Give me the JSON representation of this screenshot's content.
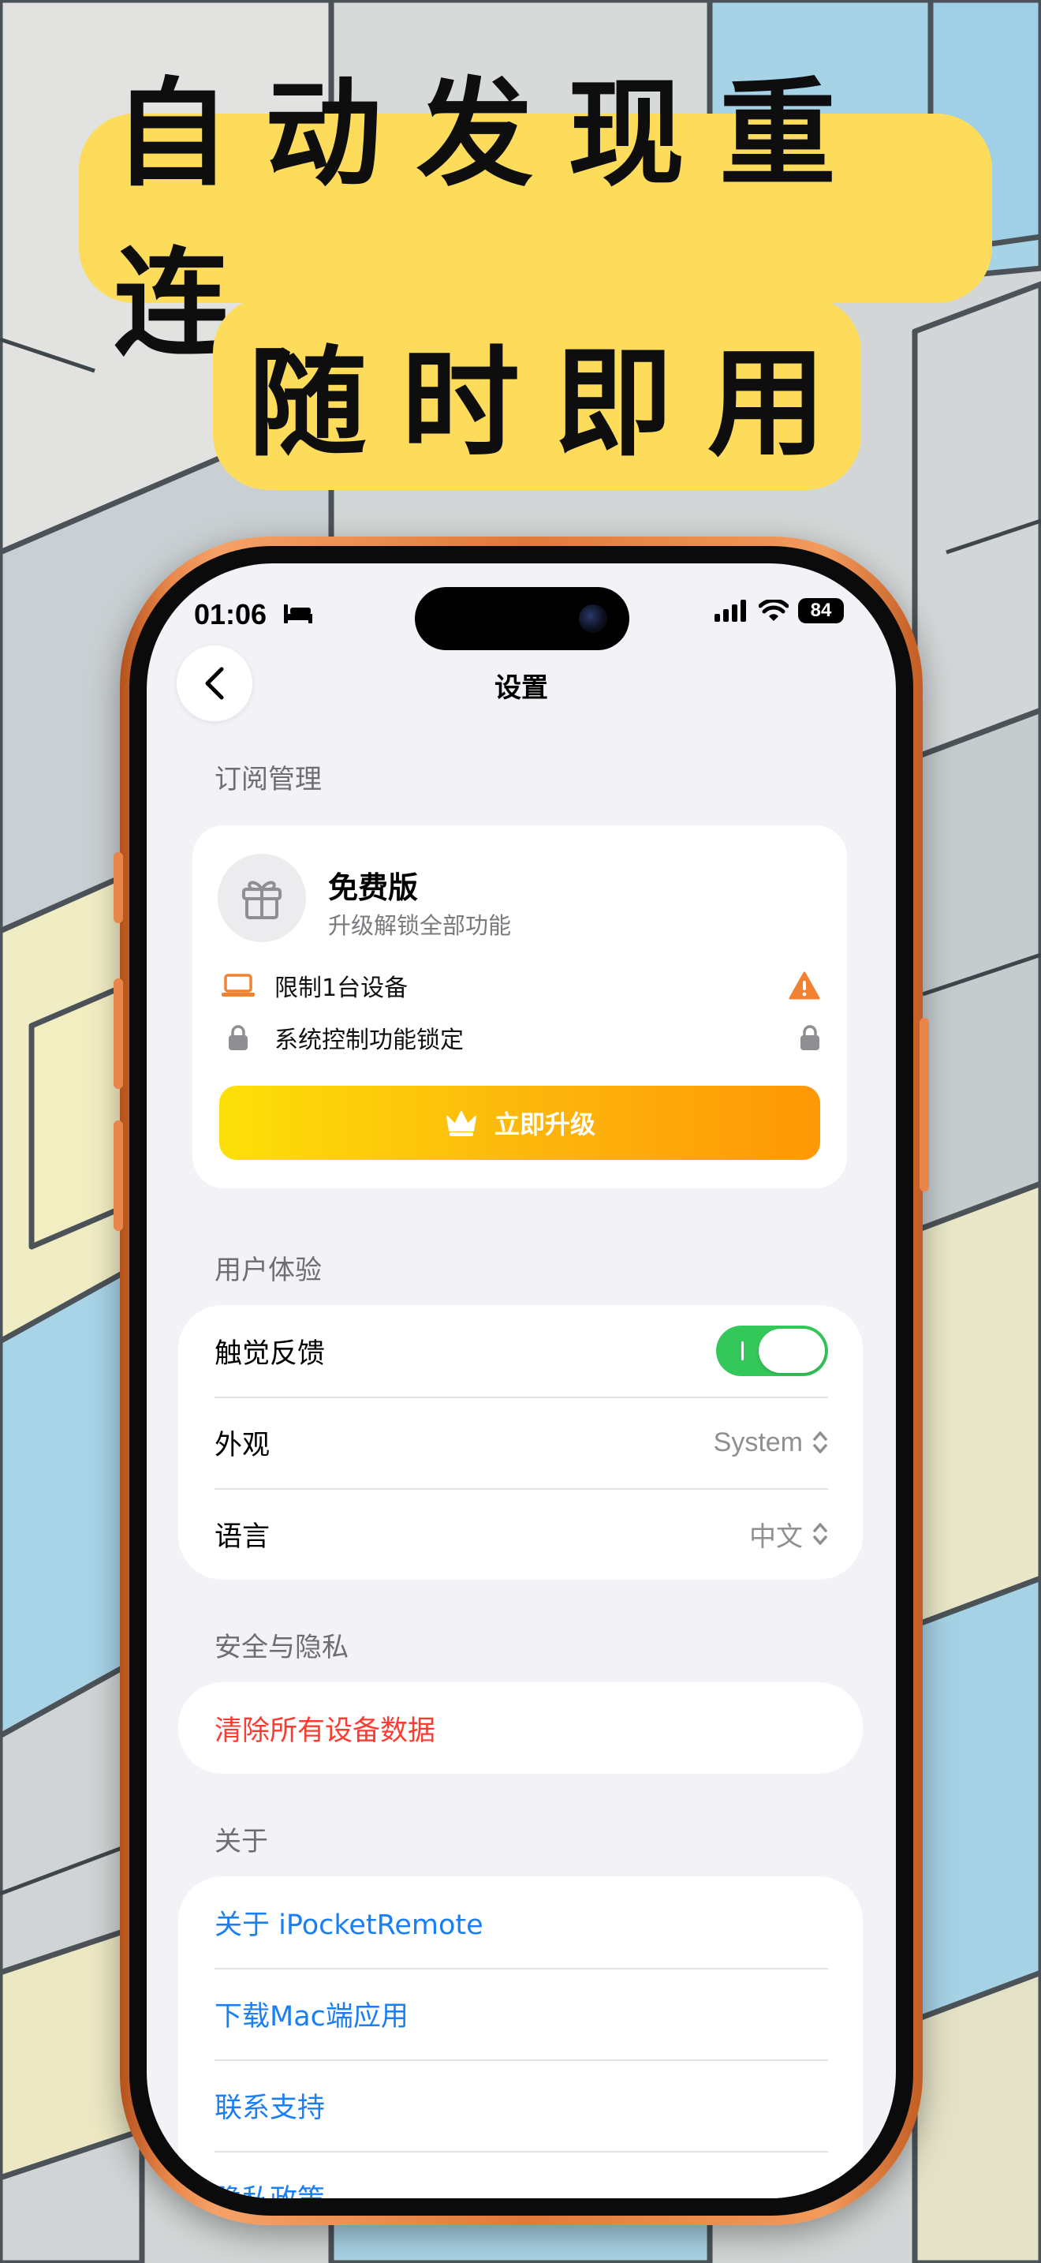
{
  "headline": {
    "line1": "自动发现重连",
    "line2": "随时即用"
  },
  "status_bar": {
    "time": "01:06",
    "battery": "84"
  },
  "nav": {
    "title": "设置"
  },
  "subscription": {
    "header": "订阅管理",
    "plan_name": "免费版",
    "plan_desc": "升级解锁全部功能",
    "features": [
      {
        "label": "限制1台设备",
        "icon": "laptop-icon",
        "end_icon": "warning-icon"
      },
      {
        "label": "系统控制功能锁定",
        "icon": "lock-icon",
        "end_icon": "lock-icon"
      }
    ],
    "upgrade_label": "立即升级"
  },
  "user_experience": {
    "header": "用户体验",
    "haptics": {
      "label": "触觉反馈",
      "enabled": true
    },
    "appearance": {
      "label": "外观",
      "value": "System"
    },
    "language": {
      "label": "语言",
      "value": "中文"
    }
  },
  "security": {
    "header": "安全与隐私",
    "clear_data": "清除所有设备数据"
  },
  "about": {
    "header": "关于",
    "items": [
      "关于 iPocketRemote",
      "下载Mac端应用",
      "联系支持",
      "隐私政策"
    ]
  },
  "colors": {
    "accent_blue": "#1a7ff5",
    "danger_red": "#ff3b30",
    "toggle_green": "#34c759",
    "banner_yellow": "#fddc5c",
    "phone_orange": "#e07a3b"
  }
}
